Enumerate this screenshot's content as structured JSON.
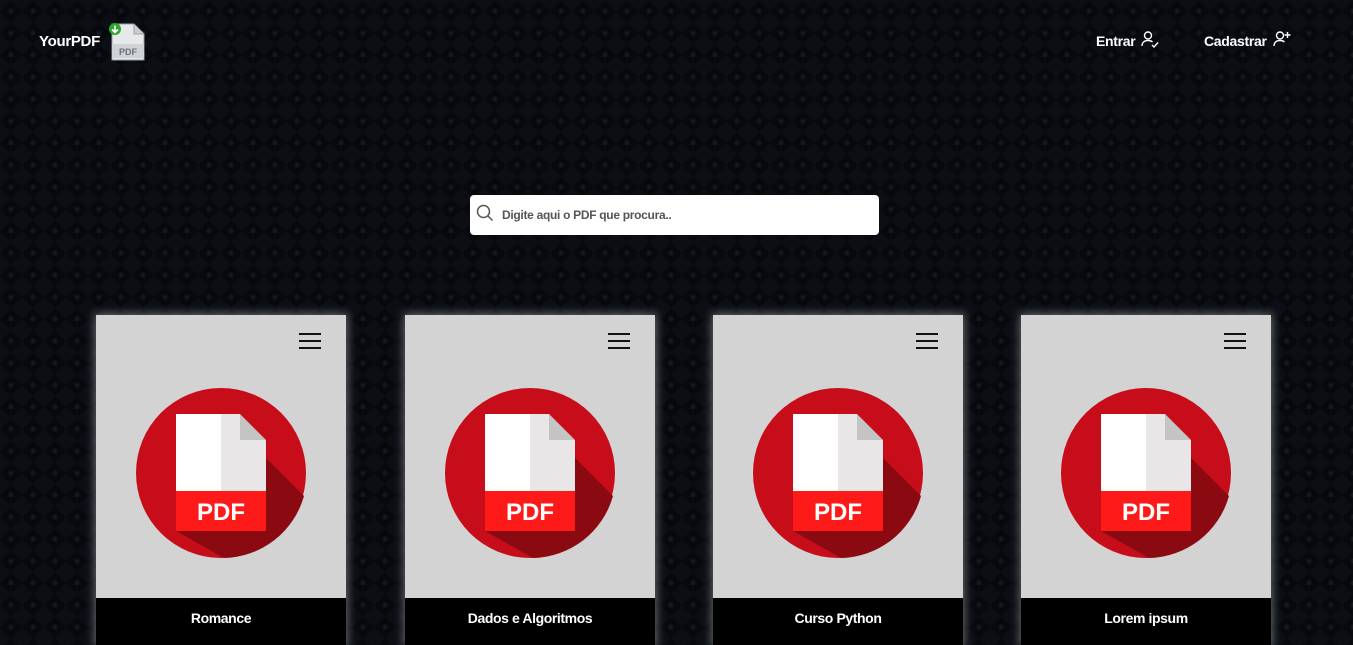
{
  "header": {
    "brand": "YourPDF",
    "logo_icon": "pdf-download-icon",
    "nav": [
      {
        "label": "Entrar",
        "icon": "user-check-icon"
      },
      {
        "label": "Cadastrar",
        "icon": "user-plus-icon"
      }
    ]
  },
  "search": {
    "placeholder": "Digite aqui o PDF que procura..",
    "icon": "search-icon"
  },
  "cards": [
    {
      "title": "Romance",
      "icon": "pdf-file-icon"
    },
    {
      "title": "Dados e Algoritmos",
      "icon": "pdf-file-icon"
    },
    {
      "title": "Curso Python",
      "icon": "pdf-file-icon"
    },
    {
      "title": "Lorem ipsum",
      "icon": "pdf-file-icon"
    }
  ],
  "colors": {
    "background": "#07090d",
    "card": "#d3d3d3",
    "pdf_red": "#c70d1a",
    "pdf_dark": "#8b0a12"
  }
}
